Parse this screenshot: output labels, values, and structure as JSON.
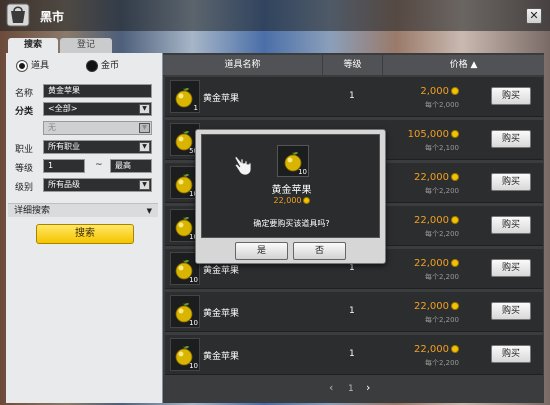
{
  "window": {
    "title": "黑市",
    "close_glyph": "✕"
  },
  "tabs": [
    {
      "label": "搜索",
      "active": true
    },
    {
      "label": "登记",
      "active": false
    }
  ],
  "filters": {
    "type_options": [
      {
        "label": "道具",
        "selected": true
      },
      {
        "label": "金币",
        "selected": false
      }
    ],
    "name_label": "名称",
    "name_value": "黄金苹果",
    "category_label": "分类",
    "category_value": "<全部>",
    "subcategory_value": "无",
    "job_label": "职业",
    "job_value": "所有职业",
    "level_label": "等级",
    "level_min": "1",
    "level_sep": "~",
    "level_max": "最高",
    "grade_label": "级别",
    "grade_value": "所有品级",
    "advanced_label": "详细搜索",
    "search_button": "搜索"
  },
  "table": {
    "headers": [
      "道具名称",
      "等级",
      "价格 ▲"
    ],
    "rows": [
      {
        "qty": "1",
        "name": "黄金苹果",
        "level": "1",
        "price": "2,000",
        "each": "每个2,000",
        "buy": "购买"
      },
      {
        "qty": "50",
        "name": "黄金苹果",
        "level": "1",
        "price": "105,000",
        "each": "每个2,100",
        "buy": "购买"
      },
      {
        "qty": "10",
        "name": "黄金苹果",
        "level": "1",
        "price": "22,000",
        "each": "每个2,200",
        "buy": "购买"
      },
      {
        "qty": "10",
        "name": "黄金苹果",
        "level": "1",
        "price": "22,000",
        "each": "每个2,200",
        "buy": "购买"
      },
      {
        "qty": "10",
        "name": "黄金苹果",
        "level": "1",
        "price": "22,000",
        "each": "每个2,200",
        "buy": "购买"
      },
      {
        "qty": "10",
        "name": "黄金苹果",
        "level": "1",
        "price": "22,000",
        "each": "每个2,200",
        "buy": "购买"
      },
      {
        "qty": "10",
        "name": "黄金苹果",
        "level": "1",
        "price": "22,000",
        "each": "每个2,200",
        "buy": "购买"
      }
    ]
  },
  "pager": {
    "prev": "‹",
    "page": "1",
    "next": "›"
  },
  "dialog": {
    "item_qty": "10",
    "item_name": "黄金苹果",
    "item_price": "22,000",
    "message": "确定要购买该道具吗?",
    "yes": "是",
    "no": "否"
  },
  "colors": {
    "price": "#f0a020",
    "accent": "#f5c400"
  }
}
